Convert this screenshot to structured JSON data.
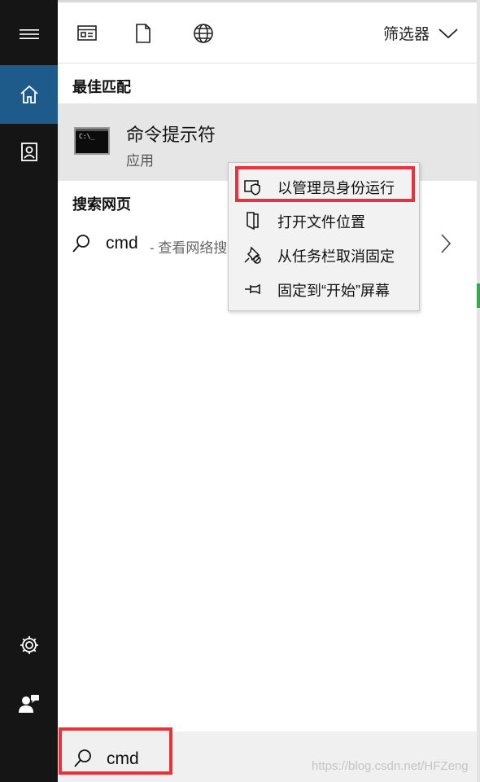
{
  "filter_label": "筛选器",
  "best_match": {
    "section_title": "最佳匹配",
    "app_name": "命令提示符",
    "app_type": "应用",
    "app_icon_text": "C:\\_"
  },
  "web_search": {
    "section_title": "搜索网页",
    "query": "cmd",
    "hint": "- 查看网络搜"
  },
  "context_menu": {
    "items": [
      {
        "label": "以管理员身份运行",
        "icon": "shield-icon"
      },
      {
        "label": "打开文件位置",
        "icon": "folder-location-icon"
      },
      {
        "label": "从任务栏取消固定",
        "icon": "unpin-icon"
      },
      {
        "label": "固定到“开始”屏幕",
        "icon": "pin-icon"
      }
    ]
  },
  "search_box": {
    "value": "cmd"
  },
  "watermark": "https://blog.csdn.net/HFZeng",
  "colors": {
    "rail_bg": "#151515",
    "rail_active": "#1e5a8a",
    "highlight_red": "#e8313a",
    "selected_row": "#e6e6e6"
  }
}
